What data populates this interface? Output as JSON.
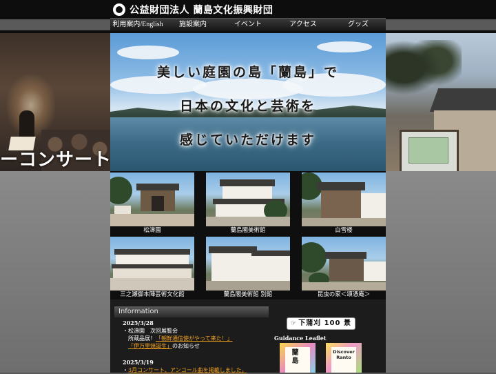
{
  "site": {
    "title": "公益財団法人 蘭島文化振興財団",
    "logo_icon": "foundation-logo-icon"
  },
  "nav": {
    "items": [
      {
        "label": "利用案内/English"
      },
      {
        "label": "施設案内"
      },
      {
        "label": "イベント"
      },
      {
        "label": "アクセス"
      },
      {
        "label": "グッズ"
      }
    ]
  },
  "side": {
    "left_caption": "ーコンサート"
  },
  "hero": {
    "lines": [
      "美しい庭園の島「蘭島」で",
      "日本の文化と芸術を",
      "感じていただけます"
    ]
  },
  "facilities": [
    {
      "name": "松濤園"
    },
    {
      "name": "蘭島閣美術館"
    },
    {
      "name": "白雪楼"
    },
    {
      "name": "三之瀬御本陣芸術文化館"
    },
    {
      "name": "蘭島閣美術館 別館"
    },
    {
      "name": "昆虫の家＜頌憑庵＞"
    }
  ],
  "info": {
    "heading": "Information",
    "news": [
      {
        "date": "2025/3/28",
        "line1": "・松濤園　次回展覧会",
        "line2_prefix": "所蔵品展！",
        "line2_link": "「朝鮮通信使がやって来た！」",
        "line3_link": "「伊万里焼誕生」",
        "line3_suffix": "のお知らせ"
      },
      {
        "date": "2025/3/19",
        "line1_prefix": "・",
        "line1_link": "3月コンサート、アンコール曲を掲載しました。"
      }
    ]
  },
  "banner": {
    "label": "下蒲刈 100 景",
    "icon": "pointing-hand-icon"
  },
  "leaflets": {
    "label": "Guidance Leaflet",
    "jp_text": "蘭島",
    "en_text": "Discover Ranto"
  },
  "colors": {
    "header_bg": "#0d0d0d",
    "link": "#f0a020",
    "panel_bg": "#1c1c1c"
  }
}
